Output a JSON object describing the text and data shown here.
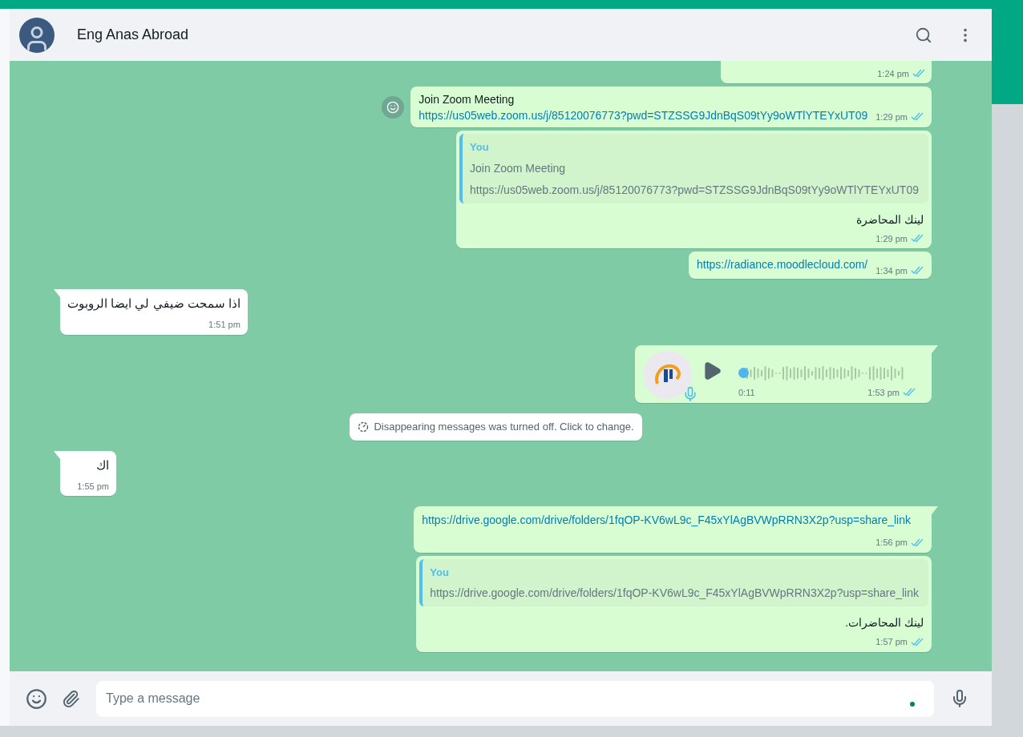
{
  "header": {
    "contact_name": "Eng Anas Abroad"
  },
  "messages": [
    {
      "kind": "partial",
      "outgoing": true,
      "tail": false,
      "time": "1:24 pm",
      "read": true
    },
    {
      "kind": "link",
      "outgoing": true,
      "tail": false,
      "reaction_button": true,
      "title": "Join Zoom Meeting",
      "link": "https://us05web.zoom.us/j/85120076773?pwd=STZSSG9JdnBqS09tYy9oWTlYTEYxUT09",
      "time": "1:29 pm",
      "read": true
    },
    {
      "kind": "quote",
      "outgoing": true,
      "tail": false,
      "quote_author": "You",
      "quote_lines": [
        "Join Zoom Meeting",
        "https://us05web.zoom.us/j/85120076773?pwd=STZSSG9JdnBqS09tYy9oWTlYTEYxUT09"
      ],
      "text": "لينك المحاضرة",
      "time": "1:29 pm",
      "read": true
    },
    {
      "kind": "inline_link",
      "outgoing": true,
      "tail": false,
      "link": "https://radiance.moodlecloud.com/",
      "time": "1:34 pm",
      "read": true
    },
    {
      "kind": "text",
      "outgoing": false,
      "tail": true,
      "text": "اذا سمحت ضيفي لي ايضا الروبوت",
      "time": "1:51 pm"
    },
    {
      "kind": "voice",
      "outgoing": true,
      "tail": true,
      "duration": "0:11",
      "level": 0,
      "time": "1:53 pm",
      "read": true
    },
    {
      "kind": "system",
      "text": "Disappearing messages was turned off. Click to change."
    },
    {
      "kind": "text",
      "outgoing": false,
      "tail": true,
      "text": "اك",
      "time": "1:55 pm"
    },
    {
      "kind": "block_link",
      "outgoing": true,
      "tail": true,
      "link": "https://drive.google.com/drive/folders/1fqOP-KV6wL9c_F45xYlAgBVWpRRN3X2p?usp=share_link",
      "time": "1:56 pm",
      "read": true
    },
    {
      "kind": "quote",
      "outgoing": true,
      "tail": false,
      "quote_author": "You",
      "quote_lines": [
        "https://drive.google.com/drive/folders/1fqOP-KV6wL9c_F45xYlAgBVWpRRN3X2p?usp=share_link"
      ],
      "text": "لينك المحاضرات.",
      "time": "1:57 pm",
      "read": true
    }
  ],
  "composer": {
    "placeholder": "Type a message"
  }
}
